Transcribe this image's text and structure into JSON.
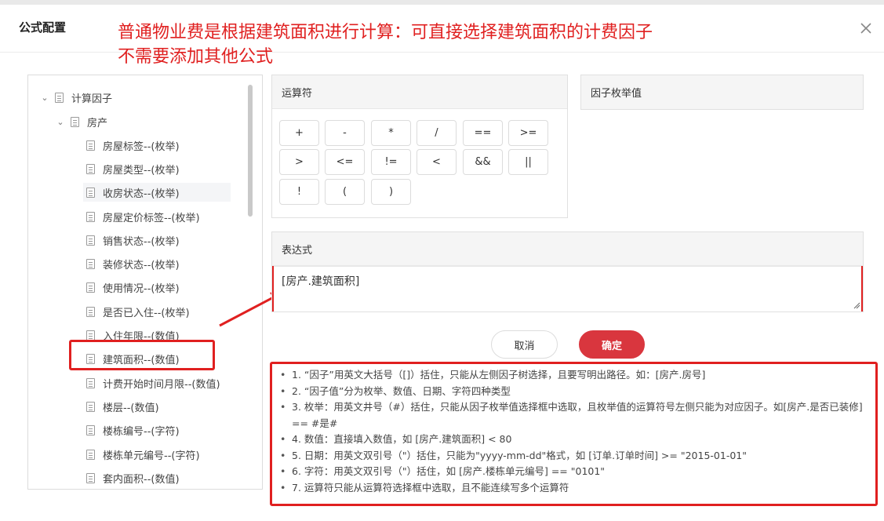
{
  "dialog": {
    "title": "公式配置"
  },
  "annotation": {
    "line1": "普通物业费是根据建筑面积进行计算：可直接选择建筑面积的计费因子",
    "line2": "不需要添加其他公式"
  },
  "tree": {
    "root": "计算因子",
    "group": "房产",
    "items": [
      "房屋标签--(枚举)",
      "房屋类型--(枚举)",
      "收房状态--(枚举)",
      "房屋定价标签--(枚举)",
      "销售状态--(枚举)",
      "装修状态--(枚举)",
      "使用情况--(枚举)",
      "是否已入住--(枚举)",
      "入住年限--(数值)",
      "建筑面积--(数值)",
      "计费开始时间月限--(数值)",
      "楼层--(数值)",
      "楼栋编号--(字符)",
      "楼栋单元编号--(字符)",
      "套内面积--(数值)"
    ]
  },
  "operators": {
    "title": "运算符",
    "buttons": [
      "+",
      "-",
      "*",
      "/",
      "==",
      ">=",
      ">",
      "<=",
      "!=",
      "<",
      "&&",
      "||",
      "!",
      "(",
      ")"
    ]
  },
  "enum_panel": {
    "title": "因子枚举值"
  },
  "expression": {
    "title": "表达式",
    "value": "[房产.建筑面积]"
  },
  "actions": {
    "cancel": "取消",
    "ok": "确定"
  },
  "notes": [
    "1. “因子”用英文大括号（[]）括住，只能从左侧因子树选择，且要写明出路径。如：[房产.房号]",
    "2. “因子值”分为枚举、数值、日期、字符四种类型",
    "3. 枚举：用英文井号（#）括住，只能从因子枚举值选择框中选取，且枚举值的运算符号左侧只能为对应因子。如[房产.是否已装修] == #是#",
    "4. 数值：直接填入数值，如 [房产.建筑面积] < 80",
    "5. 日期：用英文双引号（\"）括住，只能为\"yyyy-mm-dd\"格式，如 [订单.订单时间] >= \"2015-01-01\"",
    "6. 字符：用英文双引号（\"）括住，如 [房产.楼栋单元编号] == \"0101\"",
    "7. 运算符只能从运算符选择框中选取，且不能连续写多个运算符"
  ]
}
